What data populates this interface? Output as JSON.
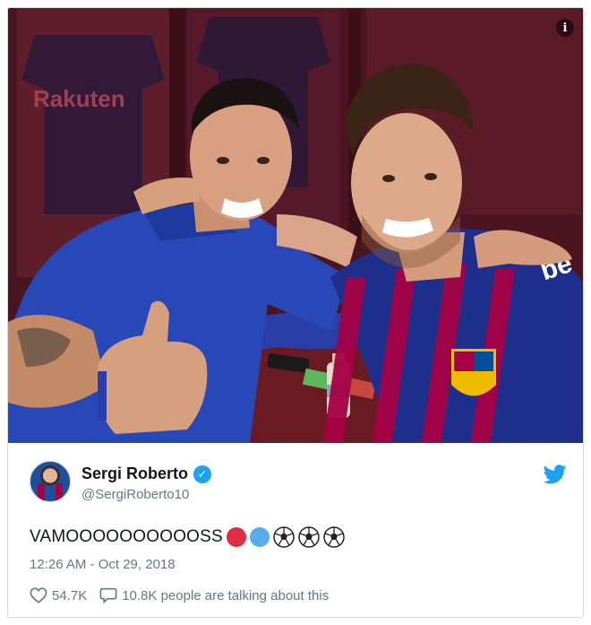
{
  "tweet": {
    "display_name": "Sergi Roberto",
    "handle": "@SergiRoberto10",
    "text": "VAMOOOOOOOOOOSS",
    "timestamp": "12:26 AM - Oct 29, 2018",
    "likes": "54.7K",
    "conversation": "10.8K people are talking about this"
  },
  "colors": {
    "twitter_blue": "#1da1f2",
    "text_primary": "#14171a",
    "text_secondary": "#657786",
    "emoji_red": "#dd2e44",
    "emoji_blue": "#55acee"
  },
  "icons": {
    "info": "info-icon",
    "verified": "verified-badge-icon",
    "twitter": "twitter-bird-icon",
    "like": "heart-icon",
    "reply": "speech-bubble-icon"
  },
  "photo": {
    "info_glyph": "i",
    "wall_text": "Rakuten",
    "shirt_text": "be"
  }
}
